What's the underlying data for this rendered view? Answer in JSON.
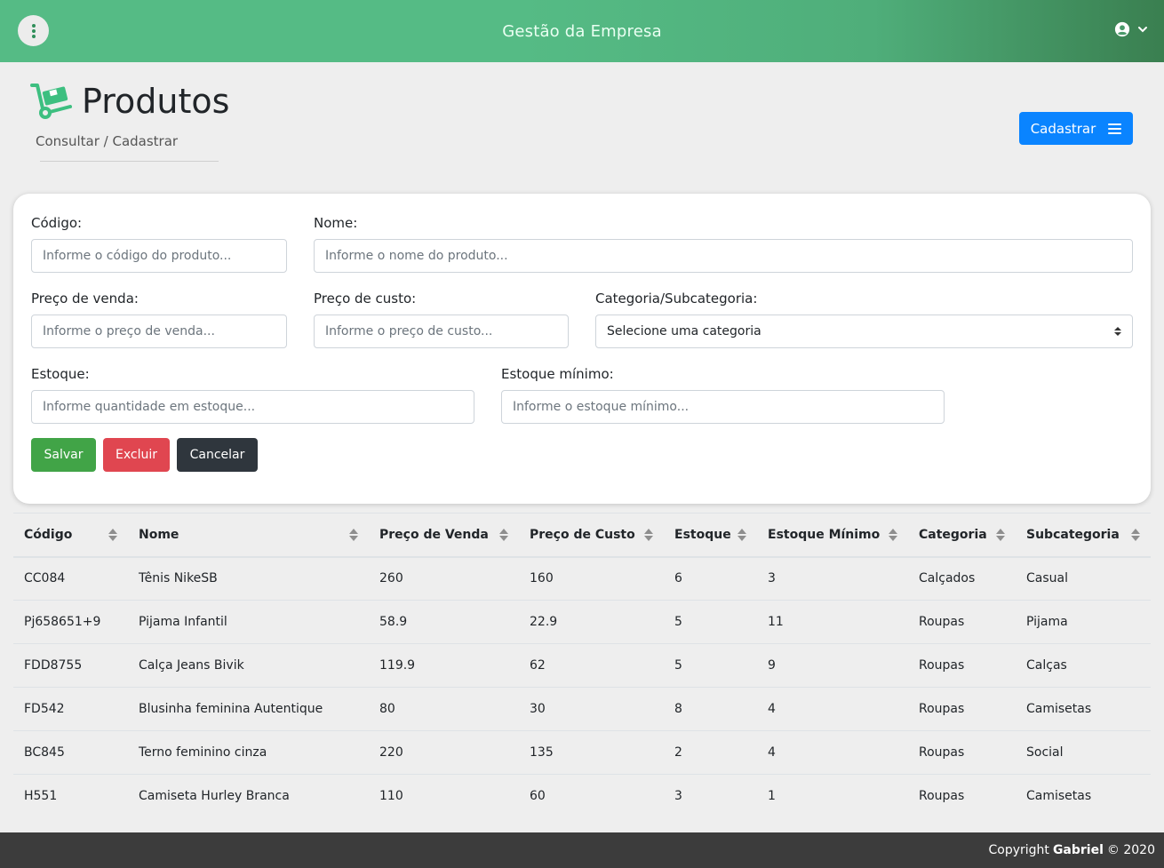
{
  "header": {
    "title": "Gestão da Empresa"
  },
  "page": {
    "title": "Produtos",
    "breadcrumb": "Consultar / Cadastrar",
    "register_button": "Cadastrar"
  },
  "form": {
    "codigo": {
      "label": "Código:",
      "placeholder": "Informe o código do produto..."
    },
    "nome": {
      "label": "Nome:",
      "placeholder": "Informe o nome do produto..."
    },
    "preco_venda": {
      "label": "Preço de venda:",
      "placeholder": "Informe o preço de venda..."
    },
    "preco_custo": {
      "label": "Preço de custo:",
      "placeholder": "Informe o preço de custo..."
    },
    "categoria": {
      "label": "Categoria/Subcategoria:",
      "selected": "Selecione uma categoria"
    },
    "estoque": {
      "label": "Estoque:",
      "placeholder": "Informe quantidade em estoque..."
    },
    "estoque_minimo": {
      "label": "Estoque mínimo:",
      "placeholder": "Informe o estoque mínimo..."
    },
    "buttons": {
      "save": "Salvar",
      "delete": "Excluir",
      "cancel": "Cancelar"
    }
  },
  "table": {
    "columns": [
      "Código",
      "Nome",
      "Preço de Venda",
      "Preço de Custo",
      "Estoque",
      "Estoque Mínimo",
      "Categoria",
      "Subcategoria"
    ],
    "rows": [
      [
        "CC084",
        "Tênis NikeSB",
        "260",
        "160",
        "6",
        "3",
        "Calçados",
        "Casual"
      ],
      [
        "Pj658651+9",
        "Pijama Infantil",
        "58.9",
        "22.9",
        "5",
        "11",
        "Roupas",
        "Pijama"
      ],
      [
        "FDD8755",
        "Calça Jeans Bivik",
        "119.9",
        "62",
        "5",
        "9",
        "Roupas",
        "Calças"
      ],
      [
        "FD542",
        "Blusinha feminina Autentique",
        "80",
        "30",
        "8",
        "4",
        "Roupas",
        "Camisetas"
      ],
      [
        "BC845",
        "Terno feminino cinza",
        "220",
        "135",
        "2",
        "4",
        "Roupas",
        "Social"
      ],
      [
        "H551",
        "Camiseta Hurley Branca",
        "110",
        "60",
        "3",
        "1",
        "Roupas",
        "Camisetas"
      ]
    ]
  },
  "footer": {
    "prefix": "Copyright",
    "author": "Gabriel",
    "suffix": "© 2020"
  },
  "colors": {
    "header_green": "#55bb85",
    "primary": "#0a84ff",
    "success": "#41a447",
    "danger": "#e04650",
    "dark": "#2f363d"
  },
  "icons": {
    "menu": "vertical-dots-icon",
    "user": "user-circle-icon",
    "dropdown": "chevron-down-icon",
    "page": "hand-truck-icon",
    "register": "bars-icon",
    "sort": "sort-icon"
  }
}
